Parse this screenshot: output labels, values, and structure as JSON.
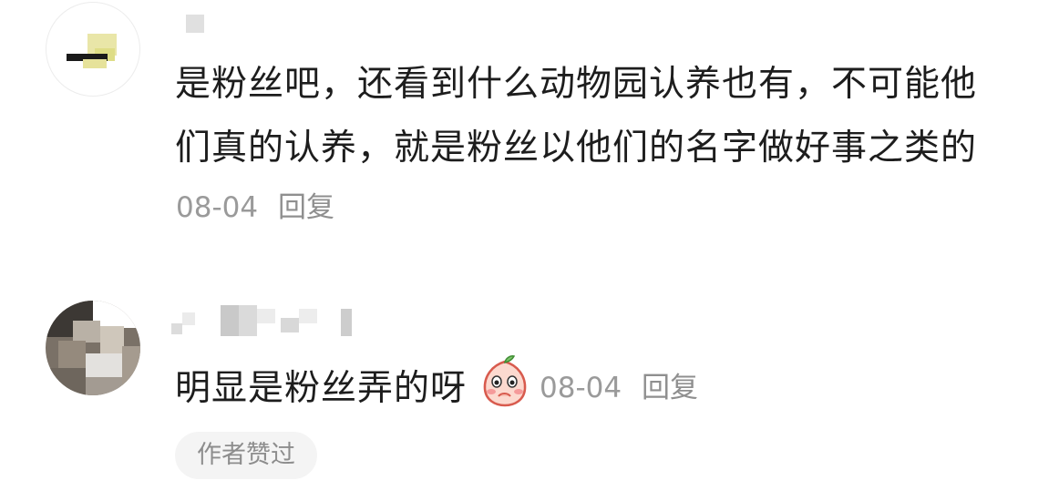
{
  "comments": [
    {
      "author": "",
      "lines": [
        "是粉丝吧，还看到什么动物园认养也有，不可能他",
        "们真的认养，就是粉丝以他们的名字做好事之类的"
      ],
      "date": "08-04",
      "reply_label": "回复"
    },
    {
      "author": "",
      "text": "明显是粉丝弄的呀",
      "emoji_icon": "blushing-peach-emoji-icon",
      "date": "08-04",
      "reply_label": "回复",
      "badge": "作者赞过"
    }
  ],
  "colors": {
    "text": "#1d1d1d",
    "meta": "#9a9a9a",
    "badge_bg": "#f4f4f4"
  }
}
